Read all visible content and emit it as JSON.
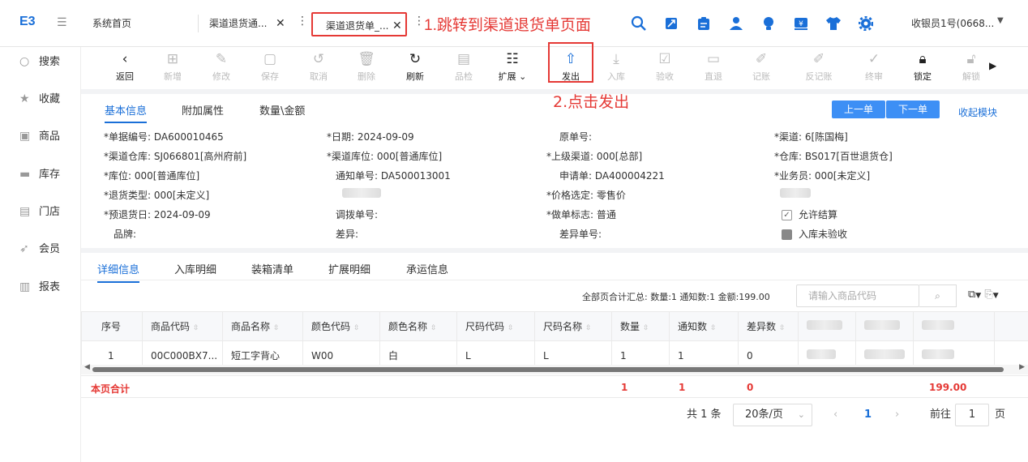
{
  "topbar": {
    "logo": "E3",
    "tabs": [
      "系统首页",
      "渠道退货通...",
      "渠道退货单_..."
    ],
    "annotation1": "1.跳转到渠道退货单页面",
    "user": "收银员1号(0668..."
  },
  "sidebar": {
    "items": [
      {
        "icon": "search-icon",
        "label": "搜索"
      },
      {
        "icon": "star-icon",
        "label": "收藏"
      },
      {
        "icon": "goods-icon",
        "label": "商品"
      },
      {
        "icon": "stock-icon",
        "label": "库存"
      },
      {
        "icon": "store-icon",
        "label": "门店"
      },
      {
        "icon": "member-icon",
        "label": "会员"
      },
      {
        "icon": "report-icon",
        "label": "报表"
      }
    ]
  },
  "toolbar": {
    "buttons": [
      "返回",
      "新增",
      "修改",
      "保存",
      "取消",
      "删除",
      "刷新",
      "品检",
      "扩展",
      "发出",
      "入库",
      "验收",
      "直退",
      "记账",
      "反记账",
      "终审",
      "锁定",
      "解锁"
    ],
    "annotation2": "2.点击发出"
  },
  "info_tabs": [
    "基本信息",
    "附加属性",
    "数量\\金额"
  ],
  "nav": {
    "prev": "上一单",
    "next": "下一单",
    "collapse": "收起模块"
  },
  "form": {
    "doc_no": "*单据编号: DA600010465",
    "date": "*日期: 2024-09-09",
    "orig_no": "原单号:",
    "channel": "*渠道: 6[陈国梅]",
    "channel_wh": "*渠道仓库: SJ066801[高州府前]",
    "channel_loc": "*渠道库位: 000[普通库位]",
    "parent_channel": "*上级渠道: 000[总部]",
    "warehouse": "*仓库: BS017[百世退货仓]",
    "location": "*库位: 000[普通库位]",
    "notice_no": "通知单号: DA500013001",
    "request_no": "申请单: DA400004221",
    "salesman": "*业务员: 000[未定义]",
    "return_type": "*退货类型: 000[未定义]",
    "price_select": "*价格选定: 零售价",
    "pre_return_date": "*预退货日: 2024-09-09",
    "transfer_no": "调拨单号:",
    "doc_flag": "*做单标志: 普通",
    "allow_settle": "允许结算",
    "brand": "品牌:",
    "diff": "差异:",
    "diff_no": "差异单号:",
    "in_uninspected": "入库未验收"
  },
  "detail_tabs": [
    "详细信息",
    "入库明细",
    "装箱清单",
    "扩展明细",
    "承运信息"
  ],
  "summary": "全部页合计汇总: 数量:1 通知数:1 金额:199.00",
  "search": {
    "placeholder": "请输入商品代码"
  },
  "table": {
    "headers": [
      "序号",
      "商品代码",
      "商品名称",
      "颜色代码",
      "颜色名称",
      "尺码代码",
      "尺码名称",
      "数量",
      "通知数",
      "差异数"
    ],
    "rows": [
      [
        "1",
        "00C000BX7...",
        "短工字背心",
        "W00",
        "白",
        "L",
        "L",
        "1",
        "1",
        "0"
      ]
    ],
    "total_label": "本页合计",
    "totals": {
      "qty": "1",
      "notice": "1",
      "diff": "0",
      "amount": "199.00"
    }
  },
  "pager": {
    "total": "共 1 条",
    "page_size": "20条/页",
    "page": "1",
    "goto": "前往",
    "goto_value": "1",
    "page_unit": "页"
  }
}
